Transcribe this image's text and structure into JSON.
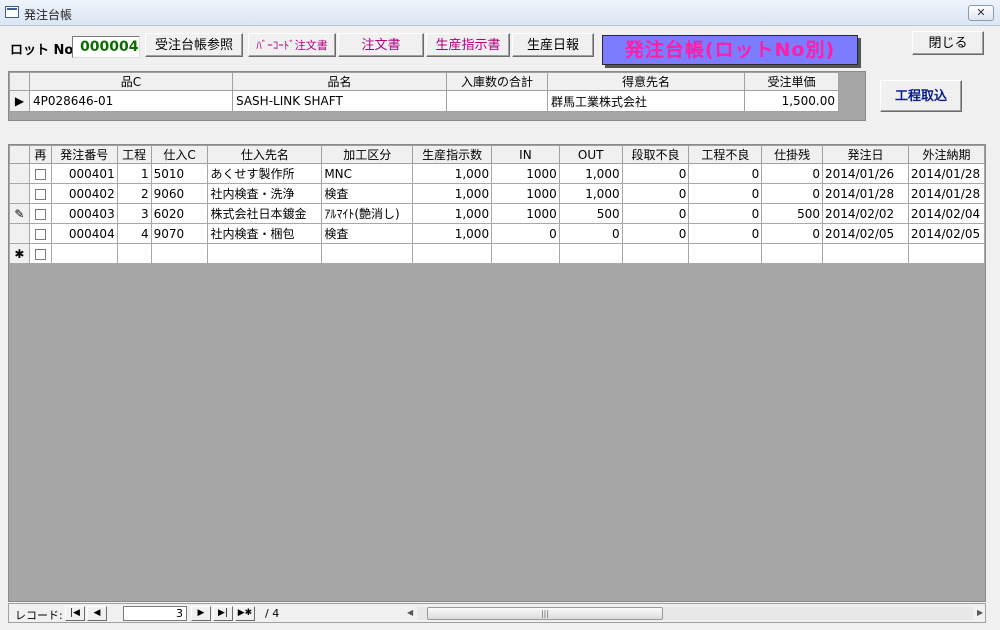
{
  "window": {
    "title": "発注台帳",
    "close_glyph": "✕"
  },
  "lot": {
    "label": "ロット No",
    "value": "000004"
  },
  "buttons": {
    "ledger_ref": "受注台帳参照",
    "barcode": "ﾊﾞｰｺｰﾄﾞ注文書",
    "order": "注文書",
    "instruction": "生産指示書",
    "daily": "生産日報",
    "close": "閉じる",
    "import": "工程取込"
  },
  "banner": "発注台帳(ロットNo別)",
  "header": {
    "columns": [
      "品C",
      "品名",
      "入庫数の合計",
      "得意先名",
      "受注単価"
    ],
    "row": {
      "selector": "▶",
      "code": "4P028646-01",
      "name": "SASH-LINK  SHAFT",
      "total": "",
      "customer": "群馬工業株式会社",
      "price": "1,500.00"
    }
  },
  "grid": {
    "columns": [
      "再",
      "発注番号",
      "工程",
      "仕入C",
      "仕入先名",
      "加工区分",
      "生産指示数",
      "IN",
      "OUT",
      "段取不良",
      "工程不良",
      "仕掛残",
      "発注日",
      "外注納期"
    ],
    "rows": [
      {
        "sel": "",
        "order_no": "000401",
        "process": "1",
        "supplier_code": "5010",
        "supplier": "あくせす製作所",
        "kind": "MNC",
        "qty": "1,000",
        "in": "1000",
        "out": "1,000",
        "setup_ng": "0",
        "process_ng": "0",
        "wip": "0",
        "order_date": "2014/01/26",
        "due": "2014/01/28"
      },
      {
        "sel": "",
        "order_no": "000402",
        "process": "2",
        "supplier_code": "9060",
        "supplier": "社内検査・洗浄",
        "kind": "検査",
        "qty": "1,000",
        "in": "1000",
        "out": "1,000",
        "setup_ng": "0",
        "process_ng": "0",
        "wip": "0",
        "order_date": "2014/01/28",
        "due": "2014/01/28"
      },
      {
        "sel": "✎",
        "order_no": "000403",
        "process": "3",
        "supplier_code": "6020",
        "supplier": "株式会社日本鍍金",
        "kind": "ｱﾙﾏｲﾄ(艶消し)",
        "qty": "1,000",
        "in": "1000",
        "out": "500",
        "setup_ng": "0",
        "process_ng": "0",
        "wip": "500",
        "order_date": "2014/02/02",
        "due": "2014/02/04"
      },
      {
        "sel": "",
        "order_no": "000404",
        "process": "4",
        "supplier_code": "9070",
        "supplier": "社内検査・梱包",
        "kind": "検査",
        "qty": "1,000",
        "in": "0",
        "out": "0",
        "setup_ng": "0",
        "process_ng": "0",
        "wip": "0",
        "order_date": "2014/02/05",
        "due": "2014/02/05"
      }
    ],
    "new_row_marker": "✱"
  },
  "navigator": {
    "label": "レコード:",
    "first": "|◀",
    "prev": "◀",
    "position": "3",
    "next": "▶",
    "last": "▶|",
    "new": "▶✱",
    "total": "/ 4"
  },
  "scrollbar": {
    "left": "◀",
    "thumb_grip": "|||",
    "right": "▶"
  }
}
